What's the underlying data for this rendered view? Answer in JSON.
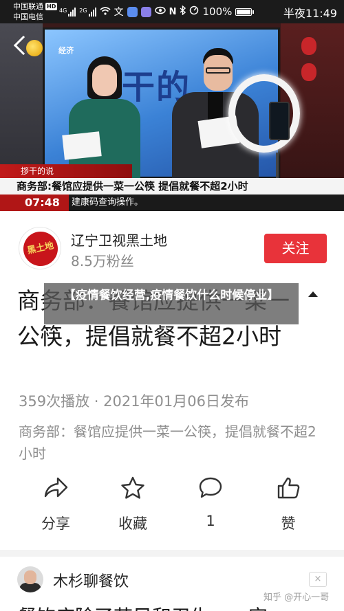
{
  "status_bar": {
    "carrier_1": "中国联通",
    "hd_badge": "HD",
    "carrier_2": "中国电信",
    "network_1": "4G",
    "network_2": "2G",
    "battery_level": "100%",
    "time": "半夜11:49",
    "icons": [
      "signal-icon",
      "wifi-icon",
      "app-notification-icon",
      "nfc-icon",
      "bluetooth-icon",
      "mute-icon",
      "eye-care-icon",
      "battery-icon"
    ]
  },
  "video": {
    "screen_text": "…干的…",
    "screen_logo": "经济",
    "caption_tag": "拶干的说",
    "caption_text": "商务部:餐馆应提供一菜一公筷 提倡就餐不超2小时",
    "ticker_time": "07:48",
    "ticker_text": "建康码查询操作。"
  },
  "author": {
    "avatar_text": "黑土地",
    "name": "辽宁卫视黑土地",
    "fans": "8.5万粉丝",
    "follow_label": "关注"
  },
  "post": {
    "title": "商务部：餐馆应提供一菜一公筷，提倡就餐不超2小时",
    "overlay_title": "【疫情餐饮经营,疫情餐饮什么时候停业】",
    "meta": "359次播放 · 2021年01月06日发布",
    "description": "商务部：餐馆应提供一菜一公筷，提倡就餐不超2小时"
  },
  "actions": [
    {
      "icon": "share-icon",
      "label": "分享"
    },
    {
      "icon": "star-icon",
      "label": "收藏"
    },
    {
      "icon": "comment-icon",
      "label": "1"
    },
    {
      "icon": "thumbs-up-icon",
      "label": "赞"
    }
  ],
  "next_card": {
    "author": "木杉聊餐饮",
    "close_label": "×",
    "title_partial": "餐饮店除了节目和卫生…一定",
    "watermark": "知乎 @开心一哥"
  },
  "colors": {
    "accent_red": "#e8333a",
    "text_primary": "#1a1a1a",
    "text_secondary": "#8f8f8f"
  }
}
